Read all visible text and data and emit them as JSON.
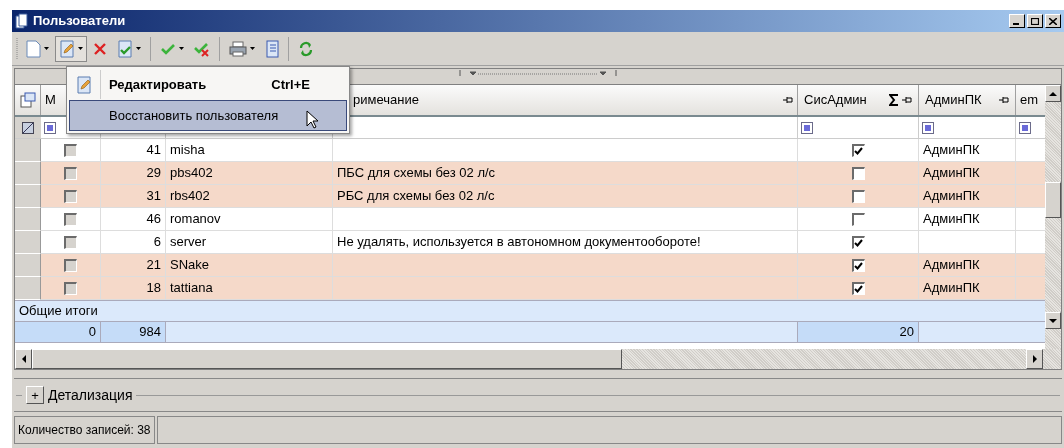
{
  "window": {
    "title": "Пользователи"
  },
  "edit_menu": {
    "items": [
      {
        "kind": "command",
        "label": "Редактировать",
        "shortcut": "Ctrl+E",
        "selected": false
      },
      {
        "kind": "plain",
        "label": "Восстановить пользователя",
        "selected": true
      }
    ]
  },
  "table": {
    "columns": [
      {
        "label": "М"
      },
      {
        "label": "римечание"
      },
      {
        "label": "СисАдмин"
      },
      {
        "label": "АдминПК"
      },
      {
        "label": "em"
      }
    ],
    "rows": [
      {
        "marked": false,
        "id": "41",
        "login": "misha",
        "note": "",
        "sysadmin": true,
        "adminpk": "АдминПК",
        "highlighted": false
      },
      {
        "marked": false,
        "id": "29",
        "login": "pbs402",
        "note": "ПБС для схемы без 02 л/с",
        "sysadmin": false,
        "adminpk": "АдминПК",
        "highlighted": true
      },
      {
        "marked": false,
        "id": "31",
        "login": "rbs402",
        "note": "РБС для схемы без 02 л/с",
        "sysadmin": false,
        "adminpk": "АдминПК",
        "highlighted": true
      },
      {
        "marked": false,
        "id": "46",
        "login": "romanov",
        "note": "",
        "sysadmin": false,
        "adminpk": "АдминПК",
        "highlighted": false
      },
      {
        "marked": false,
        "id": "6",
        "login": "server",
        "note": "Не удалять, используется в автономном документообороте!",
        "sysadmin": true,
        "adminpk": "",
        "highlighted": false
      },
      {
        "marked": false,
        "id": "21",
        "login": "SNake",
        "note": "",
        "sysadmin": true,
        "adminpk": "АдминПК",
        "highlighted": true
      },
      {
        "marked": false,
        "id": "18",
        "login": "tattiana",
        "note": "",
        "sysadmin": true,
        "adminpk": "АдминПК",
        "highlighted": true
      }
    ],
    "totals_label": "Общие итоги",
    "totals": {
      "marked": "0",
      "id": "984",
      "sysadmin": "20"
    }
  },
  "detail_panel": {
    "label": "Детализация",
    "toggle": "+"
  },
  "status_bar": {
    "record_count": "Количество записей: 38"
  }
}
